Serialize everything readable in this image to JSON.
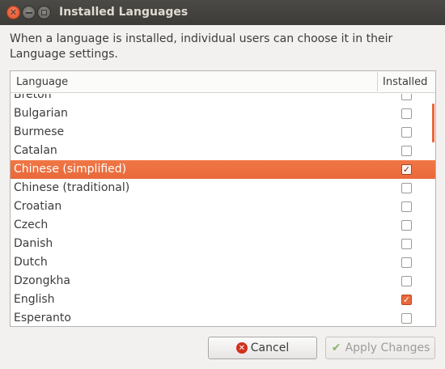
{
  "window": {
    "title": "Installed Languages"
  },
  "description": "When a language is installed, individual users can choose it in their Language settings.",
  "list": {
    "columns": [
      "Language",
      "Installed"
    ],
    "rows": [
      {
        "label": "Breton",
        "installed": false
      },
      {
        "label": "Bulgarian",
        "installed": false
      },
      {
        "label": "Burmese",
        "installed": false
      },
      {
        "label": "Catalan",
        "installed": false
      },
      {
        "label": "Chinese (simplified)",
        "installed": true
      },
      {
        "label": "Chinese (traditional)",
        "installed": false
      },
      {
        "label": "Croatian",
        "installed": false
      },
      {
        "label": "Czech",
        "installed": false
      },
      {
        "label": "Danish",
        "installed": false
      },
      {
        "label": "Dutch",
        "installed": false
      },
      {
        "label": "Dzongkha",
        "installed": false
      },
      {
        "label": "English",
        "installed": true
      },
      {
        "label": "Esperanto",
        "installed": false
      }
    ],
    "selected_row": "Chinese (simplified)"
  },
  "buttons": {
    "cancel": "Cancel",
    "apply": "Apply Changes"
  },
  "colors": {
    "accent": "#e9683a",
    "titlebar": "#3c3b37"
  }
}
